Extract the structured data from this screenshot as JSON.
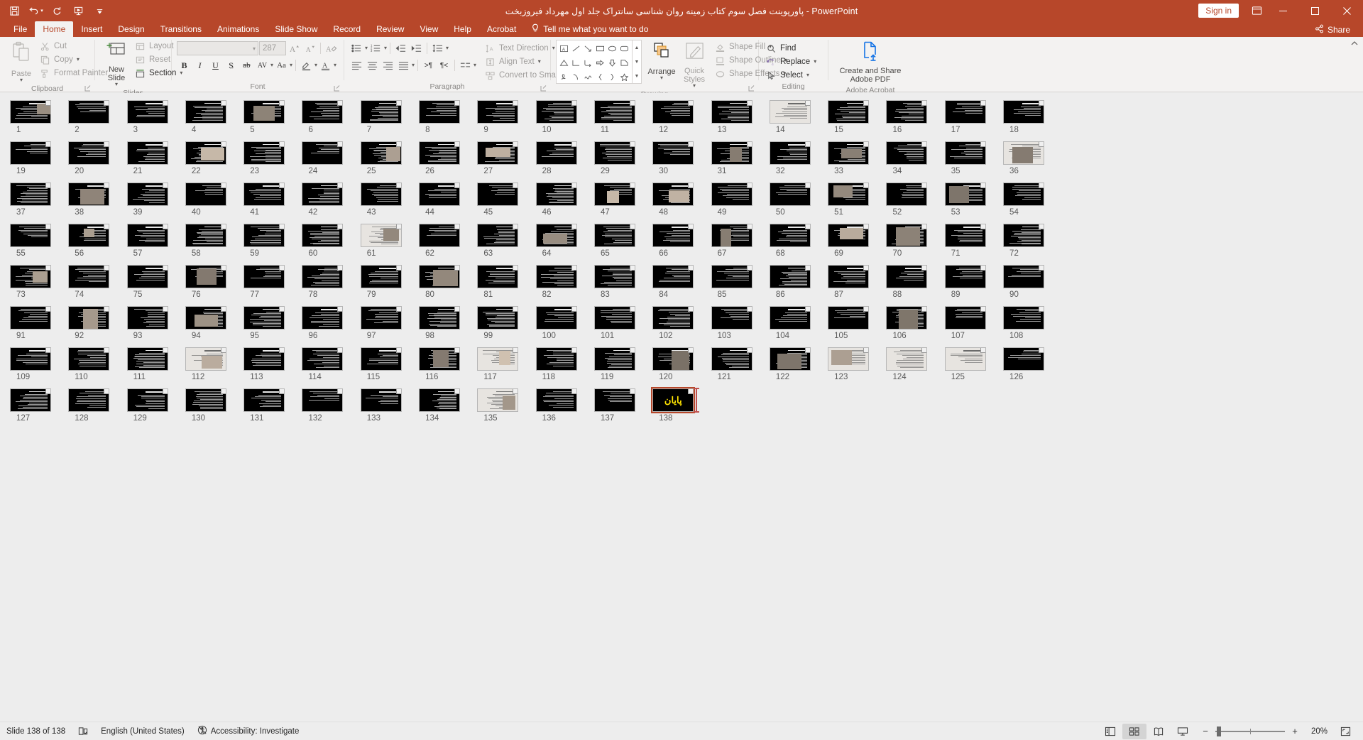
{
  "window": {
    "title": "پاورپوینت فصل سوم کتاب زمینه روان شناسی سانتراک جلد اول مهرداد فیروزبخت  -  PowerPoint",
    "sign_in": "Sign in",
    "minimize": "—",
    "restore": "❐",
    "close": "✕",
    "accent": "#b7472a"
  },
  "quick_access": [
    {
      "name": "save-icon",
      "tip": "Save"
    },
    {
      "name": "undo-icon",
      "tip": "Undo"
    },
    {
      "name": "redo-icon",
      "tip": "Redo"
    },
    {
      "name": "start-presentation-icon",
      "tip": "Start From Beginning"
    },
    {
      "name": "customize-qat-icon",
      "tip": "Customize Quick Access Toolbar"
    }
  ],
  "tabs": [
    {
      "label": "File",
      "active": false
    },
    {
      "label": "Home",
      "active": true
    },
    {
      "label": "Insert",
      "active": false
    },
    {
      "label": "Design",
      "active": false
    },
    {
      "label": "Transitions",
      "active": false
    },
    {
      "label": "Animations",
      "active": false
    },
    {
      "label": "Slide Show",
      "active": false
    },
    {
      "label": "Record",
      "active": false
    },
    {
      "label": "Review",
      "active": false
    },
    {
      "label": "View",
      "active": false
    },
    {
      "label": "Help",
      "active": false
    },
    {
      "label": "Acrobat",
      "active": false
    }
  ],
  "tell_me": "Tell me what you want to do",
  "share": "Share",
  "ribbon": {
    "clipboard": {
      "label": "Clipboard",
      "paste": "Paste",
      "cut": "Cut",
      "copy": "Copy",
      "format_painter": "Format Painter"
    },
    "slides": {
      "label": "Slides",
      "new_slide": "New Slide",
      "layout": "Layout",
      "reset": "Reset",
      "section": "Section"
    },
    "font": {
      "label": "Font",
      "font_name": "",
      "font_size": "287",
      "bold": "B",
      "italic": "I",
      "underline": "U",
      "shadow": "S",
      "strikethrough": "ab",
      "spacing": "AV",
      "change_case": "Aa"
    },
    "paragraph": {
      "label": "Paragraph",
      "text_direction": "Text Direction",
      "align_text": "Align Text",
      "convert_to_smartart": "Convert to SmartArt"
    },
    "drawing": {
      "label": "Drawing",
      "arrange": "Arrange",
      "quick_styles": "Quick Styles",
      "shape_fill": "Shape Fill",
      "shape_outline": "Shape Outline",
      "shape_effects": "Shape Effects"
    },
    "editing": {
      "label": "Editing",
      "find": "Find",
      "replace": "Replace",
      "select": "Select"
    },
    "acrobat": {
      "label": "Adobe Acrobat",
      "create_share": "Create and Share",
      "create_share_2": "Adobe PDF"
    }
  },
  "slides": {
    "total": 138,
    "selected": 138,
    "last_slide_text": "پایان",
    "last_slide_color": "#ffe400",
    "insert_cursor_after": 138
  },
  "status": {
    "slide_indicator": "Slide 138 of 138",
    "notes_icon": "notes-icon",
    "language": "English (United States)",
    "accessibility": "Accessibility: Investigate",
    "views": [
      {
        "name": "normal-view-button",
        "active": false
      },
      {
        "name": "slide-sorter-view-button",
        "active": true
      },
      {
        "name": "reading-view-button",
        "active": false
      },
      {
        "name": "slide-show-button",
        "active": false
      }
    ],
    "zoom_out": "−",
    "zoom_in": "+",
    "zoom_level": "20%",
    "fit_to_window": "fit-slide-icon"
  }
}
